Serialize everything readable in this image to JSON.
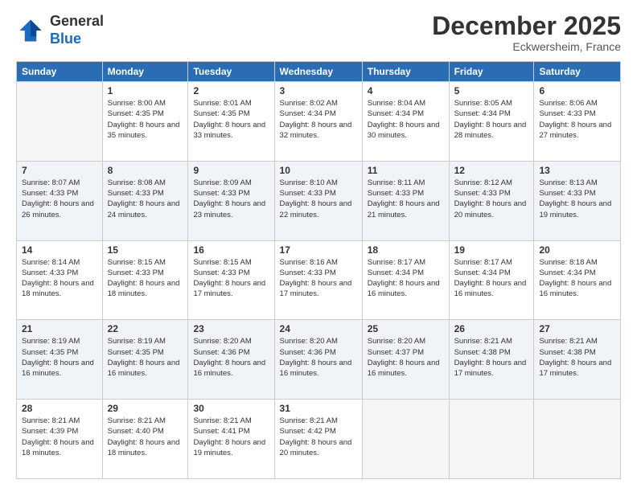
{
  "logo": {
    "general": "General",
    "blue": "Blue"
  },
  "title": "December 2025",
  "subtitle": "Eckwersheim, France",
  "days_header": [
    "Sunday",
    "Monday",
    "Tuesday",
    "Wednesday",
    "Thursday",
    "Friday",
    "Saturday"
  ],
  "weeks": [
    [
      {
        "day": "",
        "sunrise": "",
        "sunset": "",
        "daylight": ""
      },
      {
        "day": "1",
        "sunrise": "Sunrise: 8:00 AM",
        "sunset": "Sunset: 4:35 PM",
        "daylight": "Daylight: 8 hours and 35 minutes."
      },
      {
        "day": "2",
        "sunrise": "Sunrise: 8:01 AM",
        "sunset": "Sunset: 4:35 PM",
        "daylight": "Daylight: 8 hours and 33 minutes."
      },
      {
        "day": "3",
        "sunrise": "Sunrise: 8:02 AM",
        "sunset": "Sunset: 4:34 PM",
        "daylight": "Daylight: 8 hours and 32 minutes."
      },
      {
        "day": "4",
        "sunrise": "Sunrise: 8:04 AM",
        "sunset": "Sunset: 4:34 PM",
        "daylight": "Daylight: 8 hours and 30 minutes."
      },
      {
        "day": "5",
        "sunrise": "Sunrise: 8:05 AM",
        "sunset": "Sunset: 4:34 PM",
        "daylight": "Daylight: 8 hours and 28 minutes."
      },
      {
        "day": "6",
        "sunrise": "Sunrise: 8:06 AM",
        "sunset": "Sunset: 4:33 PM",
        "daylight": "Daylight: 8 hours and 27 minutes."
      }
    ],
    [
      {
        "day": "7",
        "sunrise": "Sunrise: 8:07 AM",
        "sunset": "Sunset: 4:33 PM",
        "daylight": "Daylight: 8 hours and 26 minutes."
      },
      {
        "day": "8",
        "sunrise": "Sunrise: 8:08 AM",
        "sunset": "Sunset: 4:33 PM",
        "daylight": "Daylight: 8 hours and 24 minutes."
      },
      {
        "day": "9",
        "sunrise": "Sunrise: 8:09 AM",
        "sunset": "Sunset: 4:33 PM",
        "daylight": "Daylight: 8 hours and 23 minutes."
      },
      {
        "day": "10",
        "sunrise": "Sunrise: 8:10 AM",
        "sunset": "Sunset: 4:33 PM",
        "daylight": "Daylight: 8 hours and 22 minutes."
      },
      {
        "day": "11",
        "sunrise": "Sunrise: 8:11 AM",
        "sunset": "Sunset: 4:33 PM",
        "daylight": "Daylight: 8 hours and 21 minutes."
      },
      {
        "day": "12",
        "sunrise": "Sunrise: 8:12 AM",
        "sunset": "Sunset: 4:33 PM",
        "daylight": "Daylight: 8 hours and 20 minutes."
      },
      {
        "day": "13",
        "sunrise": "Sunrise: 8:13 AM",
        "sunset": "Sunset: 4:33 PM",
        "daylight": "Daylight: 8 hours and 19 minutes."
      }
    ],
    [
      {
        "day": "14",
        "sunrise": "Sunrise: 8:14 AM",
        "sunset": "Sunset: 4:33 PM",
        "daylight": "Daylight: 8 hours and 18 minutes."
      },
      {
        "day": "15",
        "sunrise": "Sunrise: 8:15 AM",
        "sunset": "Sunset: 4:33 PM",
        "daylight": "Daylight: 8 hours and 18 minutes."
      },
      {
        "day": "16",
        "sunrise": "Sunrise: 8:15 AM",
        "sunset": "Sunset: 4:33 PM",
        "daylight": "Daylight: 8 hours and 17 minutes."
      },
      {
        "day": "17",
        "sunrise": "Sunrise: 8:16 AM",
        "sunset": "Sunset: 4:33 PM",
        "daylight": "Daylight: 8 hours and 17 minutes."
      },
      {
        "day": "18",
        "sunrise": "Sunrise: 8:17 AM",
        "sunset": "Sunset: 4:34 PM",
        "daylight": "Daylight: 8 hours and 16 minutes."
      },
      {
        "day": "19",
        "sunrise": "Sunrise: 8:17 AM",
        "sunset": "Sunset: 4:34 PM",
        "daylight": "Daylight: 8 hours and 16 minutes."
      },
      {
        "day": "20",
        "sunrise": "Sunrise: 8:18 AM",
        "sunset": "Sunset: 4:34 PM",
        "daylight": "Daylight: 8 hours and 16 minutes."
      }
    ],
    [
      {
        "day": "21",
        "sunrise": "Sunrise: 8:19 AM",
        "sunset": "Sunset: 4:35 PM",
        "daylight": "Daylight: 8 hours and 16 minutes."
      },
      {
        "day": "22",
        "sunrise": "Sunrise: 8:19 AM",
        "sunset": "Sunset: 4:35 PM",
        "daylight": "Daylight: 8 hours and 16 minutes."
      },
      {
        "day": "23",
        "sunrise": "Sunrise: 8:20 AM",
        "sunset": "Sunset: 4:36 PM",
        "daylight": "Daylight: 8 hours and 16 minutes."
      },
      {
        "day": "24",
        "sunrise": "Sunrise: 8:20 AM",
        "sunset": "Sunset: 4:36 PM",
        "daylight": "Daylight: 8 hours and 16 minutes."
      },
      {
        "day": "25",
        "sunrise": "Sunrise: 8:20 AM",
        "sunset": "Sunset: 4:37 PM",
        "daylight": "Daylight: 8 hours and 16 minutes."
      },
      {
        "day": "26",
        "sunrise": "Sunrise: 8:21 AM",
        "sunset": "Sunset: 4:38 PM",
        "daylight": "Daylight: 8 hours and 17 minutes."
      },
      {
        "day": "27",
        "sunrise": "Sunrise: 8:21 AM",
        "sunset": "Sunset: 4:38 PM",
        "daylight": "Daylight: 8 hours and 17 minutes."
      }
    ],
    [
      {
        "day": "28",
        "sunrise": "Sunrise: 8:21 AM",
        "sunset": "Sunset: 4:39 PM",
        "daylight": "Daylight: 8 hours and 18 minutes."
      },
      {
        "day": "29",
        "sunrise": "Sunrise: 8:21 AM",
        "sunset": "Sunset: 4:40 PM",
        "daylight": "Daylight: 8 hours and 18 minutes."
      },
      {
        "day": "30",
        "sunrise": "Sunrise: 8:21 AM",
        "sunset": "Sunset: 4:41 PM",
        "daylight": "Daylight: 8 hours and 19 minutes."
      },
      {
        "day": "31",
        "sunrise": "Sunrise: 8:21 AM",
        "sunset": "Sunset: 4:42 PM",
        "daylight": "Daylight: 8 hours and 20 minutes."
      },
      {
        "day": "",
        "sunrise": "",
        "sunset": "",
        "daylight": ""
      },
      {
        "day": "",
        "sunrise": "",
        "sunset": "",
        "daylight": ""
      },
      {
        "day": "",
        "sunrise": "",
        "sunset": "",
        "daylight": ""
      }
    ]
  ]
}
